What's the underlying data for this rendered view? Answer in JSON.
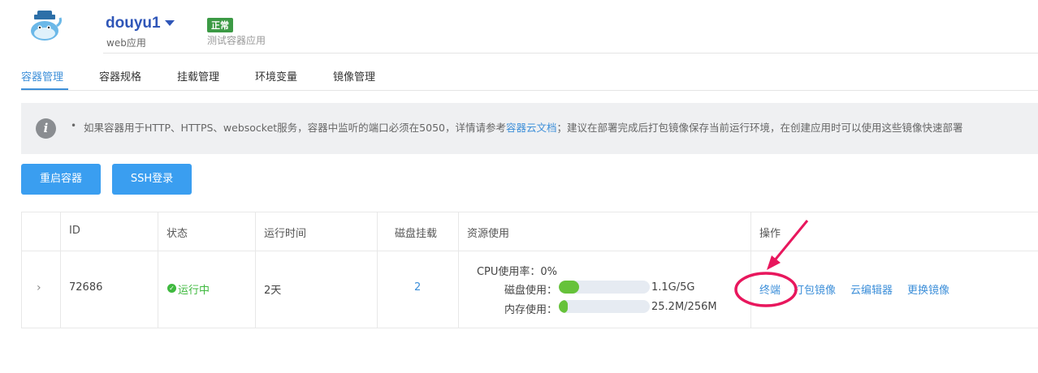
{
  "header": {
    "app_name": "douyu1",
    "app_type": "web应用",
    "status_badge": "正常",
    "description": "测试容器应用",
    "logo_icon": "docker-whale-icon"
  },
  "tabs": [
    {
      "label": "容器管理",
      "active": true
    },
    {
      "label": "容器规格",
      "active": false
    },
    {
      "label": "挂载管理",
      "active": false
    },
    {
      "label": "环境变量",
      "active": false
    },
    {
      "label": "镜像管理",
      "active": false
    }
  ],
  "notice": {
    "icon": "info-icon",
    "bullet": "•",
    "text_before": "如果容器用于HTTP、HTTPS、websocket服务，容器中监听的端口必须在5050，详情请参考",
    "link_text": "容器云文档",
    "text_after": "；建议在部署完成后打包镜像保存当前运行环境，在创建应用时可以使用这些镜像快速部署"
  },
  "buttons": {
    "restart": "重启容器",
    "ssh": "SSH登录"
  },
  "table": {
    "headers": {
      "id": "ID",
      "status": "状态",
      "uptime": "运行时间",
      "disk": "磁盘挂载",
      "resources": "资源使用",
      "actions": "操作"
    },
    "row": {
      "expand": "›",
      "id": "72686",
      "status": "运行中",
      "uptime": "2天",
      "disk_mounts": "2",
      "cpu_label": "CPU使用率：",
      "cpu_value": "0%",
      "disk_label": "磁盘使用：",
      "disk_value": "1.1G/5G",
      "disk_fraction": 0.22,
      "mem_label": "内存使用：",
      "mem_value": "25.2M/256M",
      "mem_fraction": 0.098,
      "actions": [
        "终端",
        "打包镜像",
        "云编辑器",
        "更换镜像"
      ]
    }
  },
  "colors": {
    "accent": "#3d8fd9",
    "running": "#3fb93f",
    "bar_fill": "#66c23a",
    "annotation": "#e8175d",
    "badge": "#3c9a45"
  }
}
